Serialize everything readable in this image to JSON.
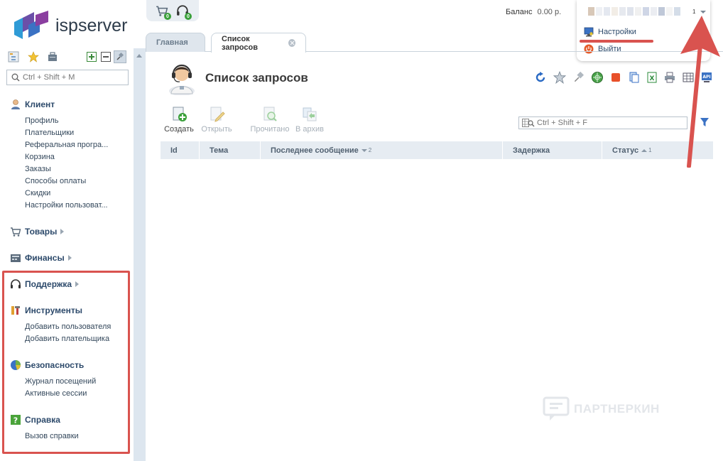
{
  "brand": {
    "name": "ispserver"
  },
  "sidebar": {
    "search_placeholder": "Ctrl + Shift + M",
    "sections": [
      {
        "label": "Клиент",
        "items": [
          "Профиль",
          "Плательщики",
          "Реферальная програ...",
          "Корзина",
          "Заказы",
          "Способы оплаты",
          "Скидки",
          "Настройки пользоват..."
        ]
      },
      {
        "label": "Товары",
        "items": []
      },
      {
        "label": "Финансы",
        "items": []
      },
      {
        "label": "Поддержка",
        "items": []
      },
      {
        "label": "Инструменты",
        "items": [
          "Добавить пользователя",
          "Добавить плательщика"
        ]
      },
      {
        "label": "Безопасность",
        "items": [
          "Журнал посещений",
          "Активные сессии"
        ]
      },
      {
        "label": "Справка",
        "items": [
          "Вызов справки"
        ]
      }
    ]
  },
  "topbar": {
    "cart_count": "0",
    "support_count": "0",
    "balance_label": "Баланс",
    "balance_value": "0.00 р.",
    "user_count": "1",
    "menu": {
      "settings": "Настройки",
      "logout": "Выйти"
    }
  },
  "tabs": [
    {
      "label": "Главная"
    },
    {
      "label": "Список запросов"
    }
  ],
  "main": {
    "title": "Список запросов",
    "actions": [
      "Создать",
      "Открыть",
      "Прочитано",
      "В архив"
    ],
    "filter_placeholder": "Ctrl + Shift + F",
    "columns": [
      {
        "label": "Id"
      },
      {
        "label": "Тема"
      },
      {
        "label": "Последнее сообщение",
        "sort": "desc",
        "order": "2"
      },
      {
        "label": "Задержка"
      },
      {
        "label": "Статус",
        "sort": "asc",
        "order": "1"
      }
    ]
  },
  "watermark": "ПАРТНЕРКИН",
  "colors": {
    "accent": "#2d4a6b",
    "highlight": "#d9534f",
    "header_bg": "#e6ecf2",
    "splitter": "#dde6ef"
  }
}
